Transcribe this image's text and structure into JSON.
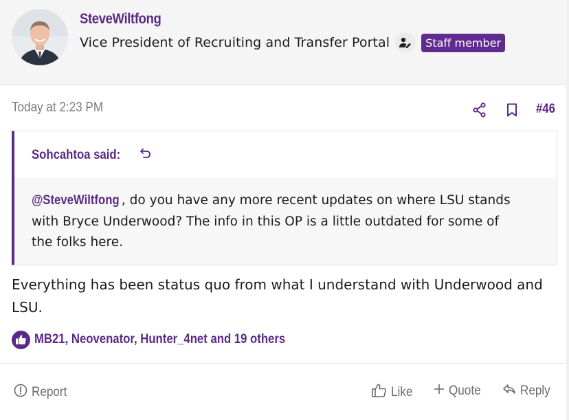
{
  "colors": {
    "accent": "#5b2a86",
    "badge_bg": "#5f2b8f",
    "text": "#141414",
    "muted": "#7a7a7a"
  },
  "author": {
    "username": "SteveWiltfong",
    "title": "Vice President of Recruiting and Transfer Portal",
    "title_icon": "user-edit-icon",
    "badge": "Staff member"
  },
  "post": {
    "date": "Today at 2:23 PM",
    "number": "#46",
    "share_icon": "share-icon",
    "bookmark_icon": "bookmark-icon",
    "body": "Everything has been status quo from what I understand with Underwood and LSU."
  },
  "quote": {
    "author": "Sohcahtoa said:",
    "mention": "@SteveWiltfong",
    "text": ", do you have any more recent updates on where LSU stands with Bryce Underwood? The info in this OP is a little outdated for some of the folks here."
  },
  "reactions": {
    "icon": "thumbs-up-icon",
    "text": "MB21, Neovenator, Hunter_4net and 19 others"
  },
  "actions": {
    "report": "Report",
    "like": "Like",
    "quote": "Quote",
    "reply": "Reply"
  }
}
